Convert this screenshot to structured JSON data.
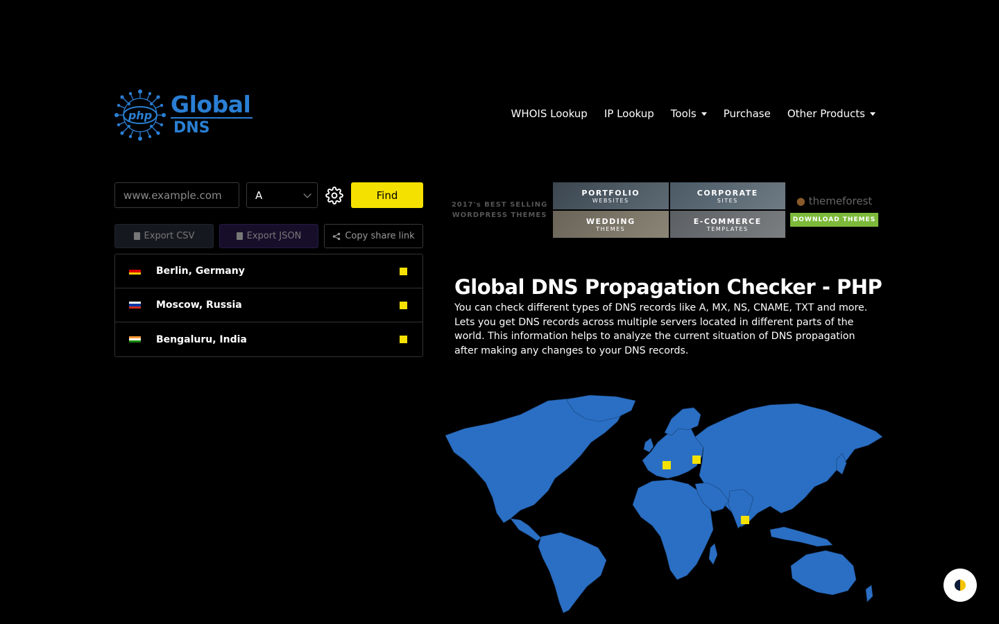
{
  "brand": {
    "logo_badge": "php",
    "name_line1": "Global",
    "name_line2": "DNS",
    "accent_color": "#2a7fd4"
  },
  "nav": {
    "items": [
      {
        "label": "WHOIS Lookup"
      },
      {
        "label": "IP Lookup"
      },
      {
        "label": "Tools"
      },
      {
        "label": "Purchase"
      },
      {
        "label": "Other Products"
      }
    ]
  },
  "search": {
    "placeholder": "www.example.com",
    "value": "",
    "record_type": "A",
    "find_label": "Find",
    "find_color": "#f5e100"
  },
  "export": {
    "csv_label": "Export CSV",
    "json_label": "Export JSON",
    "share_label": "Copy share link"
  },
  "servers": [
    {
      "location": "Berlin, Germany",
      "flag": "germany-flag",
      "status_color": "#f5e100"
    },
    {
      "location": "Moscow, Russia",
      "flag": "russia-flag",
      "status_color": "#f5e100"
    },
    {
      "location": "Bengaluru, India",
      "flag": "india-flag",
      "status_color": "#f5e100"
    }
  ],
  "ad": {
    "tagline1": "2017's BEST SELLING",
    "tagline2": "WORDPRESS THEMES",
    "tiles": [
      {
        "title": "PORTFOLIO",
        "subtitle": "WEBSITES"
      },
      {
        "title": "CORPORATE",
        "subtitle": "SITES"
      },
      {
        "title": "WEDDING",
        "subtitle": "THEMES"
      },
      {
        "title": "E-COMMERCE",
        "subtitle": "TEMPLATES"
      }
    ],
    "brand": "themeforest",
    "cta": "DOWNLOAD THEMES"
  },
  "content": {
    "title": "Global DNS Propagation Checker - PHP",
    "description": "You can check different types of DNS records like A, MX, NS, CNAME, TXT and more. Lets you get DNS records across multiple servers located in different parts of the world. This information helps to analyze the current situation of DNS propagation after making any changes to your DNS records."
  },
  "map": {
    "land_color": "#2a6fc4",
    "marker_color": "#f5e100"
  }
}
